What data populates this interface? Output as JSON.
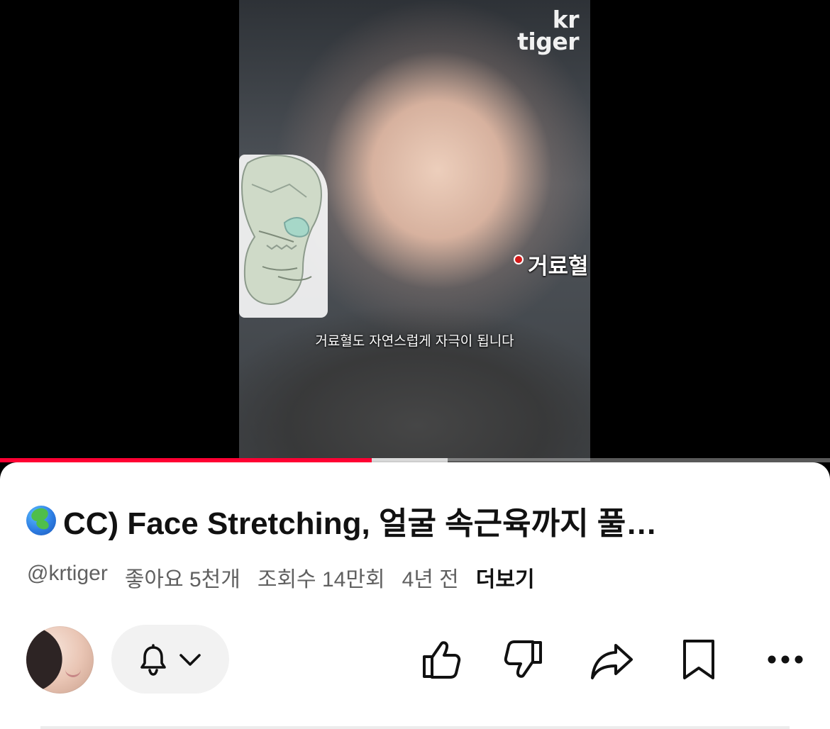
{
  "video": {
    "watermark": "kr\ntiger",
    "subtitle": "거료혈도 자연스럽게 자극이 됩니다",
    "overlay_label": "거료혈",
    "progress": {
      "played_fraction": 0.448,
      "buffered_fraction": 0.539
    }
  },
  "details": {
    "title": "CC) Face Stretching, 얼굴 속근육까지 풀…",
    "channel_handle": "@krtiger",
    "likes": "좋아요 5천개",
    "views": "조회수 14만회",
    "age": "4년 전",
    "more": "더보기"
  },
  "icons": {
    "globe": "globe-icon",
    "bell": "bell-icon",
    "chevron": "chevron-down-icon",
    "like": "thumbs-up-icon",
    "dislike": "thumbs-down-icon",
    "share": "share-icon",
    "save": "bookmark-icon",
    "menu": "more-icon"
  },
  "colors": {
    "progress": "#ff0033",
    "background": "#ffffff",
    "text": "#111111",
    "meta": "#606060"
  }
}
